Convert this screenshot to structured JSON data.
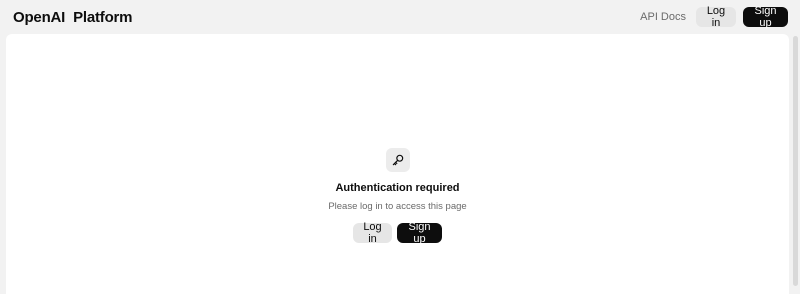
{
  "header": {
    "brand": "OpenAI  Platform",
    "api_docs": "API Docs",
    "login": "Log in",
    "signup": "Sign up"
  },
  "auth": {
    "icon": "key-icon",
    "title": "Authentication required",
    "subtitle": "Please log in to access this page",
    "login": "Log in",
    "signup": "Sign up"
  },
  "colors": {
    "page_bg": "#f2f2f2",
    "panel_bg": "#ffffff",
    "primary_button": "#0d0d0d",
    "secondary_button": "#e6e6e6"
  }
}
